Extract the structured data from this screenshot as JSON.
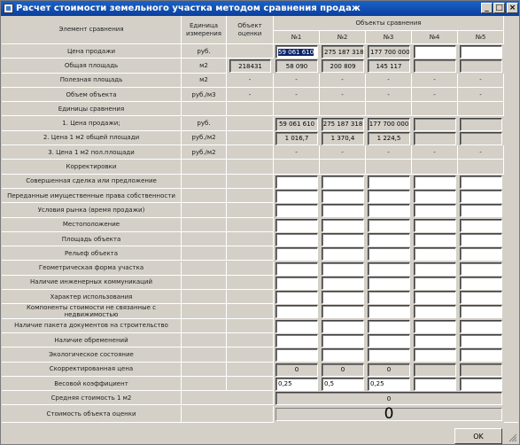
{
  "window": {
    "title": "Расчет стоимости земельного участка методом сравнения продаж"
  },
  "header": {
    "element": "Элемент сравнения",
    "unit": "Единица измерения",
    "subject": "Объект оценки",
    "objects": "Объекты сравнения",
    "obj_labels": [
      "№1",
      "№2",
      "№3",
      "№4",
      "№5"
    ]
  },
  "rows": [
    {
      "label": "Цена продажи",
      "unit": "руб.",
      "subject": "",
      "vals": [
        "59 061 610",
        "275 187 318",
        "177 700 000",
        "",
        ""
      ]
    },
    {
      "label": "Общая площадь",
      "unit": "м2",
      "subject": "218431",
      "vals": [
        "58 090",
        "200 809",
        "145 117",
        "",
        ""
      ]
    },
    {
      "label": "Полезная площадь",
      "unit": "м2",
      "subject": "-",
      "vals": [
        "-",
        "-",
        "-",
        "-",
        "-"
      ]
    },
    {
      "label": "Объем объекта",
      "unit": "руб./м3",
      "subject": "-",
      "vals": [
        "-",
        "-",
        "-",
        "-",
        "-"
      ]
    },
    {
      "label": "Единицы сравнения",
      "unit": "",
      "subject": "",
      "vals": []
    },
    {
      "label": "1. Цена продажи;",
      "unit": "руб.",
      "subject": "",
      "vals": [
        "59 061 610",
        "275 187 318",
        "177 700 000",
        "",
        ""
      ]
    },
    {
      "label": "2. Цена 1 м2 общей площади",
      "unit": "руб./м2",
      "subject": "",
      "vals": [
        "1 016,7",
        "1 370,4",
        "1 224,5",
        "",
        ""
      ]
    },
    {
      "label": "3. Цена 1 м2 пол.площади",
      "unit": "руб./м2",
      "subject": "",
      "vals": [
        "-",
        "-",
        "-",
        "-",
        "-"
      ]
    },
    {
      "label": "Корректировки",
      "unit": "",
      "subject": "",
      "vals": []
    },
    {
      "label": "Совершенная сделка или предложение",
      "unit": "",
      "subject": "",
      "vals": [
        "",
        "",
        "",
        "",
        ""
      ]
    },
    {
      "label": "Переданные имущественные права собственности",
      "unit": "",
      "subject": "",
      "vals": [
        "",
        "",
        "",
        "",
        ""
      ]
    },
    {
      "label": "Условия рынка (время продажи)",
      "unit": "",
      "subject": "",
      "vals": [
        "",
        "",
        "",
        "",
        ""
      ]
    },
    {
      "label": "Местоположение",
      "unit": "",
      "subject": "",
      "vals": [
        "",
        "",
        "",
        "",
        ""
      ]
    },
    {
      "label": "Площадь объекта",
      "unit": "",
      "subject": "",
      "vals": [
        "",
        "",
        "",
        "",
        ""
      ]
    },
    {
      "label": "Рельеф  объекта",
      "unit": "",
      "subject": "",
      "vals": [
        "",
        "",
        "",
        "",
        ""
      ]
    },
    {
      "label": "Геометрическая форма участка",
      "unit": "",
      "subject": "",
      "vals": [
        "",
        "",
        "",
        "",
        ""
      ]
    },
    {
      "label": "Наличие инженерных коммуникаций",
      "unit": "",
      "subject": "",
      "vals": [
        "",
        "",
        "",
        "",
        ""
      ]
    },
    {
      "label": "Характер  использования",
      "unit": "",
      "subject": "",
      "vals": [
        "",
        "",
        "",
        "",
        ""
      ]
    },
    {
      "label": "Компоненты стоимости не связанные с недвижимостью",
      "unit": "",
      "subject": "",
      "vals": [
        "",
        "",
        "",
        "",
        ""
      ]
    },
    {
      "label": "Наличие пакета документов на строительство",
      "unit": "",
      "subject": "",
      "vals": [
        "",
        "",
        "",
        "",
        ""
      ]
    },
    {
      "label": "Наличие обременений",
      "unit": "",
      "subject": "",
      "vals": [
        "",
        "",
        "",
        "",
        ""
      ]
    },
    {
      "label": "Экологическое состояние",
      "unit": "",
      "subject": "",
      "vals": [
        "",
        "",
        "",
        "",
        ""
      ]
    },
    {
      "label": "Скорректированная цена",
      "unit": "",
      "subject": "",
      "vals": [
        "0",
        "0",
        "0",
        "",
        ""
      ]
    },
    {
      "label": "Весовой коэффициент",
      "unit": "",
      "subject": "",
      "vals": [
        "0,25",
        "0,5",
        "0,25",
        "",
        ""
      ]
    }
  ],
  "avg": {
    "label": "Средняя стоимость 1 м2",
    "value": "0"
  },
  "total": {
    "label": "Стоимость объекта оценки",
    "value": "0"
  },
  "buttons": {
    "ok": "OK",
    "minimize": "_",
    "maximize": "□",
    "close": "×"
  }
}
